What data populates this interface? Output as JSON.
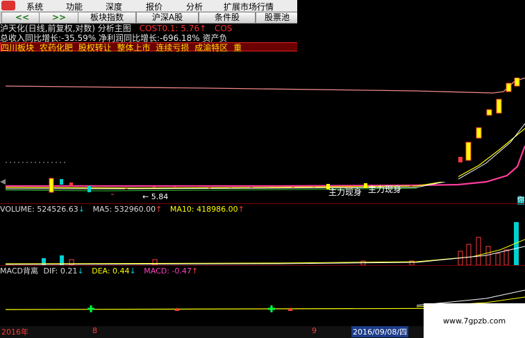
{
  "menu": [
    "系统",
    "功能",
    "深度",
    "报价",
    "分析",
    "扩展市场行情"
  ],
  "toolbar": {
    "prev": "<<",
    "next": ">>",
    "buttons": [
      "板块指数",
      "沪深A股",
      "条件股",
      "股票池"
    ]
  },
  "title": {
    "stock": "泸天化(日线,前复权,对数) 分析主图",
    "cost1": "COST0.1: 5.76",
    "cost1_arrow": "↑",
    "cost2": "COS"
  },
  "finance": "总收入同比增长:-35.59% 净利润同比增长:-696.18% 资产负",
  "tags": [
    "四川板块",
    "农药化肥",
    "股权转让",
    "整体上市",
    "连续亏损",
    "成渝特区",
    "重"
  ],
  "price_chart": {
    "low_label": "← 5.84",
    "signal_1": "主力现身",
    "signal_2": "主力现身",
    "right_marker": "你"
  },
  "volume": {
    "vol_label": "VOLUME: 524526.63",
    "vol_arrow": "↓",
    "ma5_label": "MA5: 532960.00",
    "ma5_arrow": "↑",
    "ma10_label": "MA10: 418986.00",
    "ma10_arrow": "↑"
  },
  "macd": {
    "name": "MACD背离",
    "dif_label": "DIF: 0.21",
    "dif_arrow": "↓",
    "dea_label": "DEA: 0.44",
    "dea_arrow": "↓",
    "macd_label": "MACD: -0.47",
    "macd_arrow": "↑"
  },
  "dates": {
    "year": "2016年",
    "m1": "8",
    "m2": "9",
    "current": "2016/09/08/四"
  },
  "watermark": "www.7gpzb.com",
  "colors": {
    "up": "#ff3b3b",
    "down": "#00d0d0",
    "yellow": "#ffff00",
    "ma_pink": "#ff3c9c",
    "ma_white": "#ffffff",
    "divider": "#7a0000"
  }
}
